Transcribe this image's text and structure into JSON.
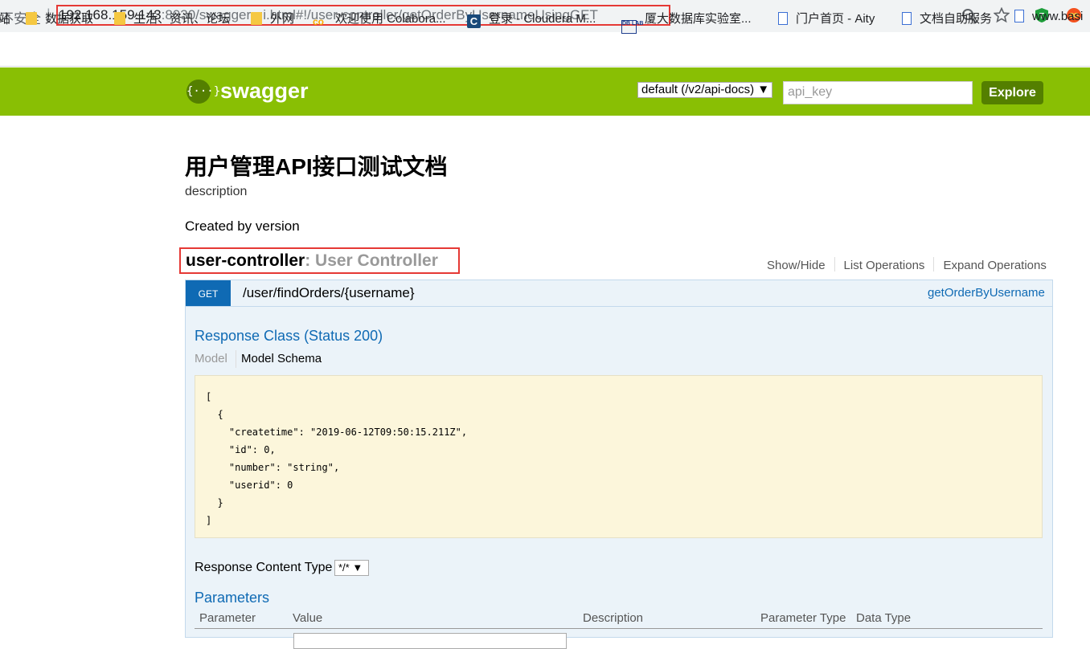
{
  "browser": {
    "insecure_label": "不安全",
    "url_host": "192.168.159.143",
    "url_rest": ":8030/swagger-ui.html#!/user-controller/getOrderByUsernameUsingGET",
    "bookmarks": [
      {
        "label": "站",
        "icon": "none"
      },
      {
        "label": "数据获取",
        "icon": "folder-icon"
      },
      {
        "label": "生活、资讯、论坛",
        "icon": "folder-icon"
      },
      {
        "label": "外网",
        "icon": "folder-icon"
      },
      {
        "label": "欢迎使用 Colabora...",
        "icon": "colab-icon"
      },
      {
        "label": "登录 - Cloudera M...",
        "icon": "cloudera-icon"
      },
      {
        "label": "厦大数据库实验室...",
        "icon": "dblab-icon"
      },
      {
        "label": "门户首页 - Aity",
        "icon": "page-icon"
      },
      {
        "label": "文档自助服务",
        "icon": "page-icon"
      },
      {
        "label": "www.basi",
        "icon": "page-icon"
      }
    ]
  },
  "swagger_header": {
    "logo_text": "{···}",
    "title": "swagger",
    "api_select": "default (/v2/api-docs)",
    "api_key_placeholder": "api_key",
    "explore_label": "Explore",
    "brand_color": "#89bf04"
  },
  "info": {
    "title": "用户管理API接口测试文档",
    "description": "description",
    "version": "Created by version"
  },
  "controller": {
    "name": "user-controller",
    "subtitle": ": User Controller",
    "actions": [
      "Show/Hide",
      "List Operations",
      "Expand Operations"
    ]
  },
  "operation": {
    "method": "GET",
    "path": "/user/findOrders/{username}",
    "nickname": "getOrderByUsername",
    "response_class": "Response Class (Status 200)",
    "model_tab": "Model",
    "schema_tab": "Model Schema",
    "schema": "[\n  {\n    \"createtime\": \"2019-06-12T09:50:15.211Z\",\n    \"id\": 0,\n    \"number\": \"string\",\n    \"userid\": 0\n  }\n]",
    "response_content_type_label": "Response Content Type",
    "response_content_type": "*/*",
    "parameters_heading": "Parameters",
    "param_columns": [
      "Parameter",
      "Value",
      "Description",
      "Parameter Type",
      "Data Type"
    ]
  }
}
